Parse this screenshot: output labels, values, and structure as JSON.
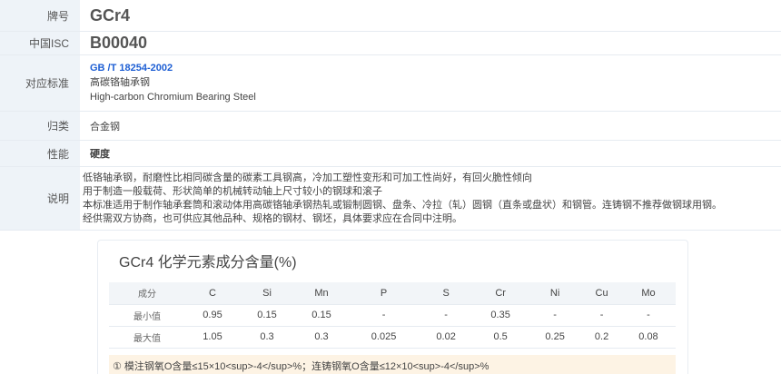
{
  "info": {
    "brand_label": "牌号",
    "brand_value": "GCr4",
    "isc_label": "中国ISC",
    "isc_value": "B00040",
    "standard_label": "对应标准",
    "standard_code": "GB /T 18254-2002",
    "standard_name_cn": "高碳铬轴承钢",
    "standard_name_en": "High-carbon Chromium Bearing Steel",
    "class_label": "归类",
    "class_value": "合金钢",
    "performance_label": "性能",
    "performance_value": "硬度",
    "description_label": "说明",
    "description_lines": [
      "低铬轴承钢，耐磨性比相同碳含量的碳素工具钢高，冷加工塑性变形和可加工性尚好，有回火脆性倾向",
      "用于制造一般载荷、形状简单的机械转动轴上尺寸较小的钢球和滚子",
      "本标准适用于制作轴承套筒和滚动体用高碳铬轴承钢热轧或锻制圆钢、盘条、冷拉（轧）圆钢（直条或盘状）和钢管。连铸钢不推荐做钢球用钢。",
      "经供需双方协商，也可供应其他品种、规格的钢材、钢坯，具体要求应在合同中注明。"
    ]
  },
  "composition": {
    "title": "GCr4 化学元素成分含量(%)",
    "columns": [
      "成分",
      "C",
      "Si",
      "Mn",
      "P",
      "S",
      "Cr",
      "Ni",
      "Cu",
      "Mo"
    ],
    "rows": [
      [
        "最小值",
        "0.95",
        "0.15",
        "0.15",
        "-",
        "-",
        "0.35",
        "-",
        "-",
        "-"
      ],
      [
        "最大值",
        "1.05",
        "0.3",
        "0.3",
        "0.025",
        "0.02",
        "0.5",
        "0.25",
        "0.2",
        "0.08"
      ]
    ],
    "note_icon": "①",
    "note": "模注钢氧O含量≤15×10<sup>-4</sup>%；连铸钢氧O含量≤12×10<sup>-4</sup>%"
  }
}
